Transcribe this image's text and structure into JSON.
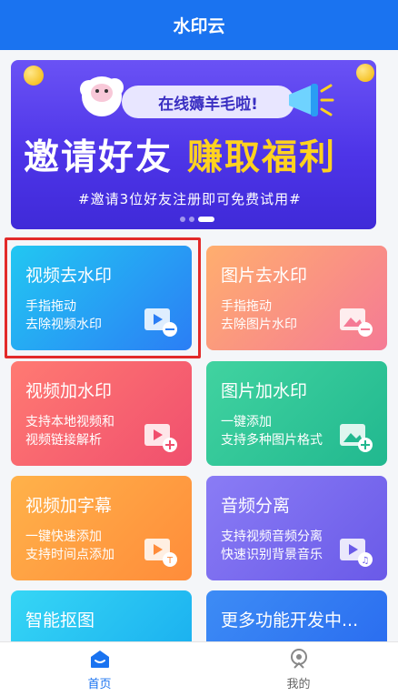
{
  "header": {
    "title": "水印云"
  },
  "banner": {
    "pill": "在线薅羊毛啦!",
    "headline_white": "邀请好友",
    "headline_yellow": "赚取福利",
    "subtitle": "#邀请3位好友注册即可免费试用#",
    "active_dot": 2
  },
  "cards": [
    {
      "title": "视频去水印",
      "line1": "手指拖动",
      "line2": "去除视频水印",
      "icon": "video-remove-icon"
    },
    {
      "title": "图片去水印",
      "line1": "手指拖动",
      "line2": "去除图片水印",
      "icon": "image-remove-icon"
    },
    {
      "title": "视频加水印",
      "line1": "支持本地视频和",
      "line2": "视频链接解析",
      "icon": "video-add-icon"
    },
    {
      "title": "图片加水印",
      "line1": "一键添加",
      "line2": "支持多种图片格式",
      "icon": "image-add-icon"
    },
    {
      "title": "视频加字幕",
      "line1": "一键快速添加",
      "line2": "支持时间点添加",
      "icon": "video-subtitle-icon"
    },
    {
      "title": "音频分离",
      "line1": "支持视频音频分离",
      "line2": "快速识别背景音乐",
      "icon": "audio-separate-icon"
    },
    {
      "title": "智能抠图",
      "line1": "",
      "line2": "",
      "icon": ""
    },
    {
      "title": "更多功能开发中...",
      "line1": "",
      "line2": "",
      "icon": ""
    }
  ],
  "tabs": [
    {
      "label": "首页",
      "icon": "home-icon",
      "active": true
    },
    {
      "label": "我的",
      "icon": "profile-icon",
      "active": false
    }
  ],
  "colors": {
    "primary": "#1a73f0",
    "highlight": "#e22a2a",
    "tab_active": "#1a73f0",
    "tab_inactive": "#666666"
  }
}
